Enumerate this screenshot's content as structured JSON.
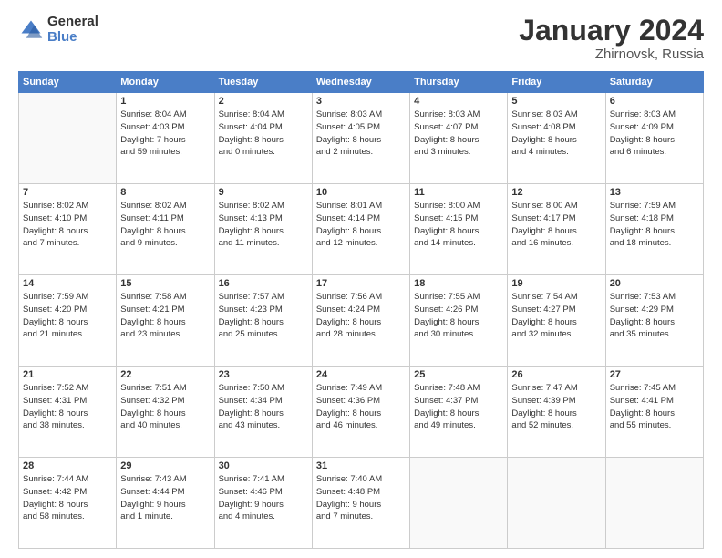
{
  "logo": {
    "general": "General",
    "blue": "Blue"
  },
  "title": {
    "month": "January 2024",
    "location": "Zhirnovsk, Russia"
  },
  "days_of_week": [
    "Sunday",
    "Monday",
    "Tuesday",
    "Wednesday",
    "Thursday",
    "Friday",
    "Saturday"
  ],
  "weeks": [
    [
      {
        "day": "",
        "info": ""
      },
      {
        "day": "1",
        "info": "Sunrise: 8:04 AM\nSunset: 4:03 PM\nDaylight: 7 hours\nand 59 minutes."
      },
      {
        "day": "2",
        "info": "Sunrise: 8:04 AM\nSunset: 4:04 PM\nDaylight: 8 hours\nand 0 minutes."
      },
      {
        "day": "3",
        "info": "Sunrise: 8:03 AM\nSunset: 4:05 PM\nDaylight: 8 hours\nand 2 minutes."
      },
      {
        "day": "4",
        "info": "Sunrise: 8:03 AM\nSunset: 4:07 PM\nDaylight: 8 hours\nand 3 minutes."
      },
      {
        "day": "5",
        "info": "Sunrise: 8:03 AM\nSunset: 4:08 PM\nDaylight: 8 hours\nand 4 minutes."
      },
      {
        "day": "6",
        "info": "Sunrise: 8:03 AM\nSunset: 4:09 PM\nDaylight: 8 hours\nand 6 minutes."
      }
    ],
    [
      {
        "day": "7",
        "info": "Sunrise: 8:02 AM\nSunset: 4:10 PM\nDaylight: 8 hours\nand 7 minutes."
      },
      {
        "day": "8",
        "info": "Sunrise: 8:02 AM\nSunset: 4:11 PM\nDaylight: 8 hours\nand 9 minutes."
      },
      {
        "day": "9",
        "info": "Sunrise: 8:02 AM\nSunset: 4:13 PM\nDaylight: 8 hours\nand 11 minutes."
      },
      {
        "day": "10",
        "info": "Sunrise: 8:01 AM\nSunset: 4:14 PM\nDaylight: 8 hours\nand 12 minutes."
      },
      {
        "day": "11",
        "info": "Sunrise: 8:00 AM\nSunset: 4:15 PM\nDaylight: 8 hours\nand 14 minutes."
      },
      {
        "day": "12",
        "info": "Sunrise: 8:00 AM\nSunset: 4:17 PM\nDaylight: 8 hours\nand 16 minutes."
      },
      {
        "day": "13",
        "info": "Sunrise: 7:59 AM\nSunset: 4:18 PM\nDaylight: 8 hours\nand 18 minutes."
      }
    ],
    [
      {
        "day": "14",
        "info": "Sunrise: 7:59 AM\nSunset: 4:20 PM\nDaylight: 8 hours\nand 21 minutes."
      },
      {
        "day": "15",
        "info": "Sunrise: 7:58 AM\nSunset: 4:21 PM\nDaylight: 8 hours\nand 23 minutes."
      },
      {
        "day": "16",
        "info": "Sunrise: 7:57 AM\nSunset: 4:23 PM\nDaylight: 8 hours\nand 25 minutes."
      },
      {
        "day": "17",
        "info": "Sunrise: 7:56 AM\nSunset: 4:24 PM\nDaylight: 8 hours\nand 28 minutes."
      },
      {
        "day": "18",
        "info": "Sunrise: 7:55 AM\nSunset: 4:26 PM\nDaylight: 8 hours\nand 30 minutes."
      },
      {
        "day": "19",
        "info": "Sunrise: 7:54 AM\nSunset: 4:27 PM\nDaylight: 8 hours\nand 32 minutes."
      },
      {
        "day": "20",
        "info": "Sunrise: 7:53 AM\nSunset: 4:29 PM\nDaylight: 8 hours\nand 35 minutes."
      }
    ],
    [
      {
        "day": "21",
        "info": "Sunrise: 7:52 AM\nSunset: 4:31 PM\nDaylight: 8 hours\nand 38 minutes."
      },
      {
        "day": "22",
        "info": "Sunrise: 7:51 AM\nSunset: 4:32 PM\nDaylight: 8 hours\nand 40 minutes."
      },
      {
        "day": "23",
        "info": "Sunrise: 7:50 AM\nSunset: 4:34 PM\nDaylight: 8 hours\nand 43 minutes."
      },
      {
        "day": "24",
        "info": "Sunrise: 7:49 AM\nSunset: 4:36 PM\nDaylight: 8 hours\nand 46 minutes."
      },
      {
        "day": "25",
        "info": "Sunrise: 7:48 AM\nSunset: 4:37 PM\nDaylight: 8 hours\nand 49 minutes."
      },
      {
        "day": "26",
        "info": "Sunrise: 7:47 AM\nSunset: 4:39 PM\nDaylight: 8 hours\nand 52 minutes."
      },
      {
        "day": "27",
        "info": "Sunrise: 7:45 AM\nSunset: 4:41 PM\nDaylight: 8 hours\nand 55 minutes."
      }
    ],
    [
      {
        "day": "28",
        "info": "Sunrise: 7:44 AM\nSunset: 4:42 PM\nDaylight: 8 hours\nand 58 minutes."
      },
      {
        "day": "29",
        "info": "Sunrise: 7:43 AM\nSunset: 4:44 PM\nDaylight: 9 hours\nand 1 minute."
      },
      {
        "day": "30",
        "info": "Sunrise: 7:41 AM\nSunset: 4:46 PM\nDaylight: 9 hours\nand 4 minutes."
      },
      {
        "day": "31",
        "info": "Sunrise: 7:40 AM\nSunset: 4:48 PM\nDaylight: 9 hours\nand 7 minutes."
      },
      {
        "day": "",
        "info": ""
      },
      {
        "day": "",
        "info": ""
      },
      {
        "day": "",
        "info": ""
      }
    ]
  ]
}
